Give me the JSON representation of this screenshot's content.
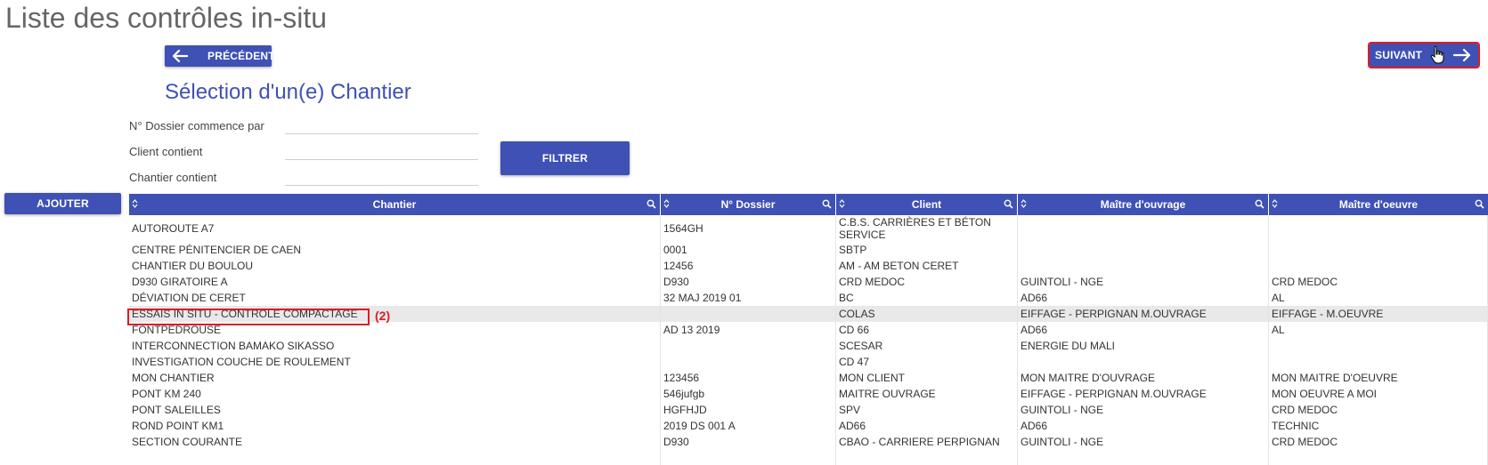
{
  "page": {
    "title": "Liste des contrôles in-situ"
  },
  "nav": {
    "prev_label": "PRÉCÉDENT",
    "next_label": "SUIVANT"
  },
  "section": {
    "title": "Sélection d'un(e) Chantier"
  },
  "filters": {
    "dossier_label": "N° Dossier commence par",
    "dossier_value": "",
    "client_label": "Client contient",
    "client_value": "",
    "chantier_label": "Chantier contient",
    "chantier_value": "",
    "filter_button": "FILTRER"
  },
  "actions": {
    "add_label": "AJOUTER"
  },
  "table": {
    "columns": [
      "Chantier",
      "N° Dossier",
      "Client",
      "Maître d'ouvrage",
      "Maître d'oeuvre"
    ],
    "rows": [
      [
        "AUTOROUTE A7",
        "1564GH",
        "C.B.S. CARRIÈRES ET BÉTON SERVICE",
        "",
        ""
      ],
      [
        "CENTRE PÉNITENCIER DE CAEN",
        "0001",
        "SBTP",
        "",
        ""
      ],
      [
        "CHANTIER DU BOULOU",
        "12456",
        "AM - AM BETON CERET",
        "",
        ""
      ],
      [
        "D930 GIRATOIRE A",
        "D930",
        "CRD MEDOC",
        "GUINTOLI - NGE",
        "CRD MEDOC"
      ],
      [
        "DÉVIATION DE CERET",
        "32 MAJ 2019 01",
        "BC",
        "AD66",
        "AL"
      ],
      [
        "ESSAIS IN SITU - CONTROLE COMPACTAGE",
        "",
        "COLAS",
        "EIFFAGE - PERPIGNAN M.OUVRAGE",
        "EIFFAGE - M.OEUVRE"
      ],
      [
        "FONTPEDROUSE",
        "AD 13 2019",
        "CD 66",
        "AD66",
        "AL"
      ],
      [
        "INTERCONNECTION BAMAKO SIKASSO",
        "",
        "SCESAR",
        "ENERGIE DU MALI",
        ""
      ],
      [
        "INVESTIGATION COUCHE DE ROULEMENT",
        "",
        "CD 47",
        "",
        ""
      ],
      [
        "MON CHANTIER",
        "123456",
        "MON CLIENT",
        "MON MAITRE D'OUVRAGE",
        "MON MAITRE D'OEUVRE"
      ],
      [
        "PONT KM 240",
        "546jufgb",
        "MAITRE OUVRAGE",
        "EIFFAGE - PERPIGNAN M.OUVRAGE",
        "MON OEUVRE A MOI"
      ],
      [
        "PONT SALEILLES",
        "HGFHJD",
        "SPV",
        "GUINTOLI - NGE",
        "CRD MEDOC"
      ],
      [
        "ROND POINT KM1",
        "2019 DS 001 A",
        "AD66",
        "AD66",
        "TECHNIC"
      ],
      [
        "SECTION COURANTE",
        "D930",
        "CBAO - CARRIERE PERPIGNAN",
        "GUINTOLI - NGE",
        "CRD MEDOC"
      ]
    ],
    "selected_row_index": 5
  },
  "annotation": {
    "label": "(2)",
    "color": "#e01b24"
  },
  "colors": {
    "primary": "#3f51b5",
    "highlight": "#e01b24",
    "selected_row": "#e9e9e9"
  }
}
